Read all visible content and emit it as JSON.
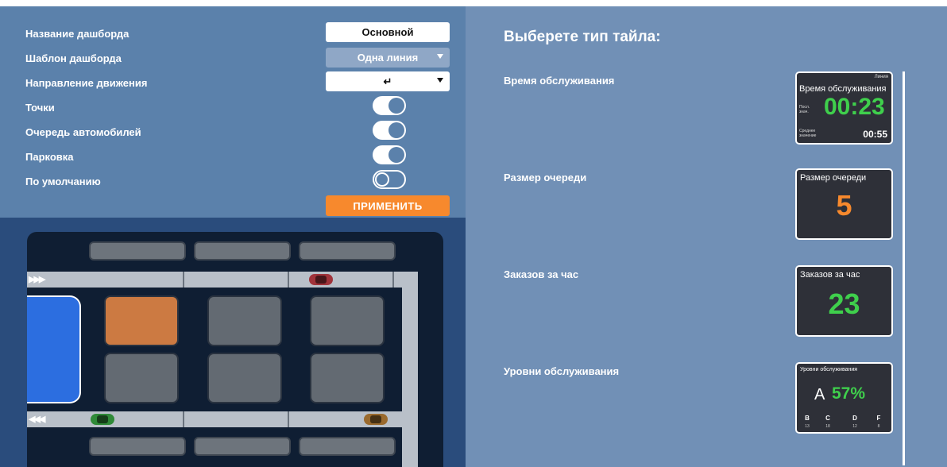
{
  "settings": {
    "rows": [
      {
        "label": "Название дашборда"
      },
      {
        "label": "Шаблон дашборда"
      },
      {
        "label": "Направление движения"
      },
      {
        "label": "Точки"
      },
      {
        "label": "Очередь автомобилей"
      },
      {
        "label": "Парковка"
      },
      {
        "label": "По умолчанию"
      }
    ],
    "name_value": "Основной",
    "template_value": "Одна линия",
    "direction_value": "↵",
    "toggles": {
      "points": true,
      "queue": true,
      "parking": true,
      "default": false
    },
    "apply_label": "ПРИМЕНИТЬ"
  },
  "map": {
    "entry_arrows": "▶▶▶",
    "exit_arrows": "◀◀◀",
    "colors": {
      "active_bay": "#cc7a42",
      "window": "#2c6ee0",
      "car_red": "#a0323a",
      "car_green": "#2f8a38",
      "car_brown": "#9a6a2e"
    }
  },
  "right": {
    "title": "Выберете тип тайла:",
    "tiles": [
      {
        "label": "Время обслуживания",
        "tag": "Линия",
        "title": "Время обслуживания",
        "last_label": "Посл. знач.",
        "value": "00:23",
        "avg_label": "Среднее значение",
        "avg_value": "00:55"
      },
      {
        "label": "Размер очереди",
        "title": "Размер очереди",
        "value": "5"
      },
      {
        "label": "Заказов за час",
        "title": "Заказов за час",
        "value": "23"
      },
      {
        "label": "Уровни обслуживания",
        "title": "Уровни обслуживания",
        "grade": "А",
        "percent": "57%",
        "grades": [
          {
            "g": "B",
            "n": "13"
          },
          {
            "g": "C",
            "n": "18"
          },
          {
            "g": "D",
            "n": "12"
          },
          {
            "g": "F",
            "n": "8"
          }
        ]
      }
    ]
  }
}
